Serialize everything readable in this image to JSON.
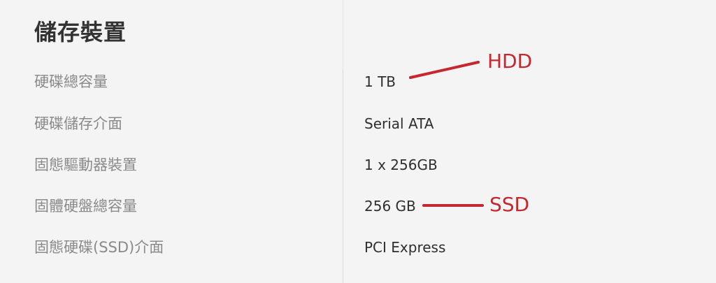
{
  "storage": {
    "title": "儲存裝置",
    "rows": [
      {
        "label": "硬碟總容量",
        "value": "1 TB"
      },
      {
        "label": "硬碟儲存介面",
        "value": "Serial ATA"
      },
      {
        "label": "固態驅動器裝置",
        "value": "1 x 256GB"
      },
      {
        "label": "固體硬盤總容量",
        "value": "256 GB"
      },
      {
        "label": "固態硬碟(SSD)介面",
        "value": "PCI Express"
      }
    ]
  },
  "annotations": {
    "hdd_label": "HDD",
    "ssd_label": "SSD",
    "color": "#c5282e"
  }
}
